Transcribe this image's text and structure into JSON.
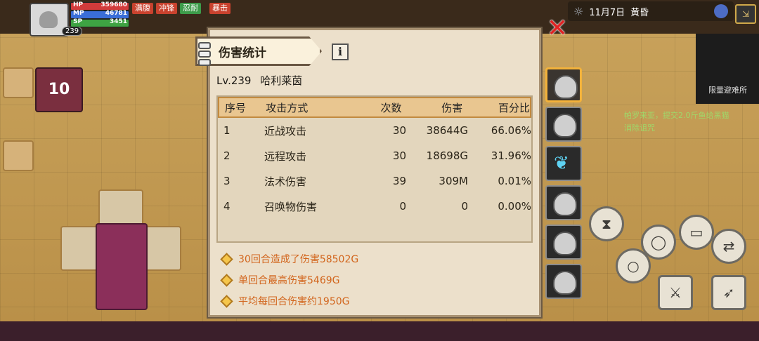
{
  "hud": {
    "hp_label": "HP",
    "hp_value": "359680",
    "mp_label": "MP",
    "mp_value": "46781",
    "sp_label": "SP",
    "sp_value": "3451",
    "level": "239",
    "status_tags": [
      "满腹",
      "冲锋",
      "忍耐",
      "暴击"
    ]
  },
  "date_bar": {
    "date": "11月7日",
    "time_of_day": "黄昏"
  },
  "dialog": {
    "title": "伤害统计",
    "character": {
      "level": "Lv.239",
      "name": "哈利莱茵"
    },
    "columns": [
      "序号",
      "攻击方式",
      "次数",
      "伤害",
      "百分比"
    ],
    "rows": [
      {
        "index": "1",
        "attack": "近战攻击",
        "count": "30",
        "damage": "38644G",
        "percent": "66.06%"
      },
      {
        "index": "2",
        "attack": "远程攻击",
        "count": "30",
        "damage": "18698G",
        "percent": "31.96%"
      },
      {
        "index": "3",
        "attack": "法术伤害",
        "count": "39",
        "damage": "309M",
        "percent": "0.01%"
      },
      {
        "index": "4",
        "attack": "召唤物伤害",
        "count": "0",
        "damage": "0",
        "percent": "0.00%"
      }
    ],
    "summary": [
      "30回合造成了伤害58502G",
      "单回合最高伤害5469G",
      "平均每回合伤害约1950G"
    ]
  },
  "background_texts": {
    "limited_avoid": "限量避难所",
    "quest": "帕罗来亚，提交2.0斤鱼给黑猫",
    "quest2": "消除诅咒"
  },
  "icons": {
    "close": "close-icon",
    "info": "info-icon",
    "sun": "sun-icon",
    "globe": "globe-icon",
    "exit": "exit-icon"
  },
  "colors": {
    "accent_orange": "#d2651c",
    "close_red": "#e02424",
    "active_slot": "#f3b23b"
  }
}
